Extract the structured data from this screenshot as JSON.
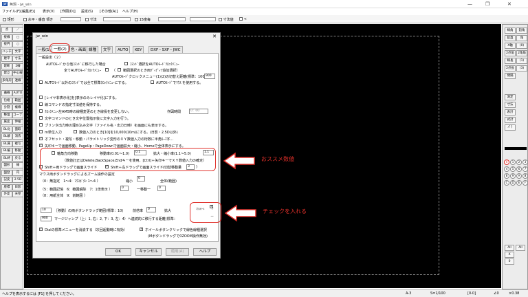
{
  "window": {
    "title": "無題 - jw_win",
    "icon": "JW",
    "controls": [
      "—",
      "❐",
      "✕"
    ]
  },
  "menu": [
    "ファイル(F)",
    "[編集(E)]",
    "表示(V)",
    "[作図(D)]",
    "設定(S)",
    "[その他(A)]",
    "ヘルプ(H)"
  ],
  "toolbar": {
    "rect": "矩形",
    "horiz": "水平・垂直",
    "angle_label": "傾き",
    "dim_label": "寸法",
    "sq15": "15度毎",
    "dims_value": "寸法値",
    "less": "<"
  },
  "left_palette": {
    "col1": [
      "点",
      "接線",
      "接円",
      "ハッチ",
      "建平",
      "建断",
      "建立",
      "多角形",
      "曲線",
      "包絡",
      "分割",
      "整理",
      "属変",
      "BL化",
      "BL解",
      "BL属",
      "BL編",
      "BL終",
      "図形",
      "図登",
      "記変",
      "座標",
      "外変"
    ],
    "col2": [
      "／",
      "□",
      "○",
      "文字",
      "寸法",
      "2線",
      "中心線",
      "連線",
      "AUTO",
      "範囲",
      "複線",
      "コーナー",
      "伸縮",
      "面取",
      "消去",
      "複写",
      "移動",
      "戻る",
      "線",
      "円",
      "2.5D",
      "日影",
      "天空"
    ]
  },
  "right_palette": {
    "col1": [
      "線角",
      "鉛直",
      "X軸",
      "2点角",
      "線長",
      "2点長",
      "間隔",
      "測定",
      "寸法",
      "表計",
      "式計",
      "ﾊﾟﾗ"
    ],
    "col2": [
      "鉛角",
      "角",
      "(0)",
      "2角角",
      "(1)",
      "(3)"
    ]
  },
  "layers": {
    "row1": [
      "0",
      "1",
      "2",
      "3",
      "4",
      "5",
      "6",
      "7",
      "8",
      "9",
      "A",
      "B",
      "C",
      "D",
      "E",
      "F"
    ],
    "all1": "All",
    "all2": "All",
    "x": "X",
    "zero": "0"
  },
  "dialog": {
    "title": "jw_win",
    "close": "✕",
    "tabs": [
      "一般(1)",
      "一般(2)",
      "色・画面",
      "線種",
      "文字",
      "AUTO",
      "KEY",
      "DXF・SXF・JWC"
    ],
    "active_tab": "一般(2)",
    "group_title": "一般設定（２）",
    "rows": {
      "r1a": "AUTOﾓｰﾄﾞから他ｺﾏﾝﾄﾞに移行した場合",
      "r1b": "ｺﾏﾝﾄﾞ選択をAUTOﾓｰﾄﾞｸﾛｯｸﾒﾆｭｰ",
      "r2a": "全てAUTOﾓｰﾄﾞｸﾛｯｸﾒﾆｭｰ",
      "r2b": "（",
      "r2c": "範囲選択のとき両ﾃﾞｨﾃﾞｨﾂ追加選択）",
      "r3a": "AUTOﾓｰﾄﾞクロックメニュー(1)(2)の切替え距離(標準：100)",
      "r3v": "900",
      "r4a": "AUTOﾓｰﾄﾞ以外のｺﾏﾝﾄﾞでは全て標準ｸﾛｯｸﾒﾆｭｰにする。",
      "r4b": "AUTOﾓｰﾄﾞでﾏｳｽ を使用する。",
      "r5": "[レイヤ非表示化]を[表示のみレイヤ化]にする。",
      "r6": "線コマンドの指定寸法値を保持する。",
      "r7": "ｸﾛｯｸﾒﾆｭｰ左AM5時の線種変更のとき線長を変更しない。",
      "r7b": "作図時間",
      "r7v": "0：00",
      "r8": "文字コマンドのとき文字位置指示後に文字入力を行う。",
      "r9": "プリンタ出力時の埋め込み文字（ファイル名・出力日時）を画面にも表示する。",
      "r10a": "m単位入力",
      "r10b": "数値入力のとき[10]を10,000(10m)にする。(日影・2.5D以外)",
      "r11": "オフセット・複写・移動・パラメトリック変形のＸＹ数値入力の桁数に半角ﾛｰﾏ字...",
      "r12": "矢印キーで画面移動、PageUp・PageDownで画面拡大・縮小、Homeで全体表示にする。",
      "r13a": "軸角方向移動",
      "r13b": "移動率(0.01〜1.0)",
      "r13v": "0.1",
      "r13c": "拡大・縮小率(1.1〜5.0)",
      "r13v2": "1.1",
      "r14": "（数値訂正はDelete,BackSpace,Endキーを使用、[Ctrl]＋矢印キーでＸＹ数値入力の確定）",
      "r15a": "Shift＋両ドラッグで画面スライド",
      "r15b": "Shift＋左ドラッグで画面スライド",
      "r15c": "(切替移動量",
      "r15v": "3",
      "r15d": ")",
      "r16": "マウス両ボタンドラッグによるズーム操作の設定",
      "r17a": "（0：無指定　1〜4：ﾏｳｽﾎﾞﾀﾝ 1〜4 ）",
      "r17b": "縮小",
      "r17v": "0",
      "r17c": "全体(範囲)",
      "r18a": "（5：範囲記憶　6：範囲解除　7：1倍表示 ）",
      "r18v": "0",
      "r18b": "一移動一",
      "r18v2": "0",
      "r19a": "（8：用紙全体　9：前範囲 ）",
      "r20v": "10",
      "r20a": "［移動］の両ボタンドラッグ範囲(標準：10)",
      "r20b": "前倍率",
      "r20v2": "0",
      "r20c": "拡大",
      "r20d": "ﾏｳｽﾎｲｰﾙ",
      "r21v": "900",
      "r21a": "マージジャンプ（上：1, 右：2, 下：3, 左：4）へ連続的に移行する距離(標準：",
      "r22a": "Dialの標準メニューを消去する（次回起動時に有効）",
      "r22b": "ホイールボタンクリックで線色線種選択",
      "r22c": "(Mボタンドラッグで0ZOOM操作無効)"
    },
    "buttons": {
      "ok": "OK",
      "cancel": "キャンセル",
      "apply": "適用(A)",
      "help": "ヘルプ"
    }
  },
  "annotations": {
    "recommended": "おススメ数値",
    "check_it": "チェックを入れる",
    "plus": "+",
    "minus": "−"
  },
  "status": {
    "hint": "ヘルプを表示するには [F1] を押してください。",
    "paper": "A-3",
    "scale": "S=1/100",
    "layer": "[0-0]",
    "angle": "∠0",
    "zoom": "×0.38"
  },
  "colors": {
    "accent_red": "#e0302a",
    "canvas": "#000000",
    "dialog_bg": "#f0f0f0"
  }
}
